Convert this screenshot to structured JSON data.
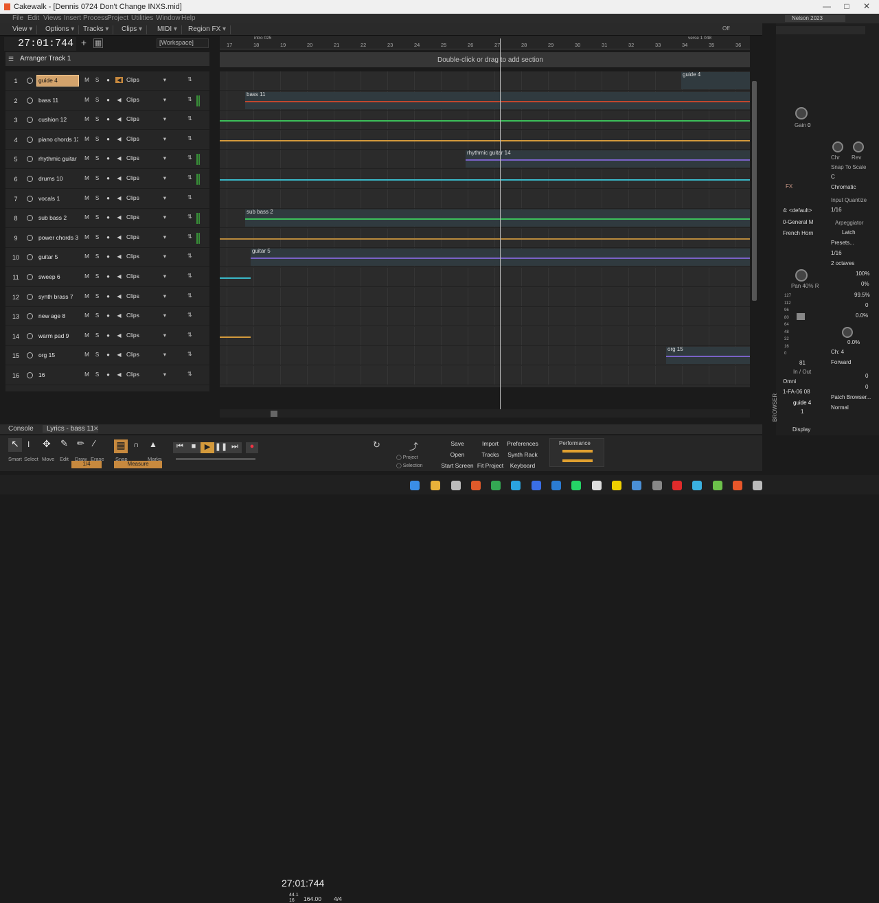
{
  "window": {
    "title": "Cakewalk - [Dennis 0724 Don't Change INXS.mid]"
  },
  "menu": [
    "File",
    "Edit",
    "Views",
    "Insert",
    "Process",
    "Project",
    "Utilities",
    "Window",
    "Help"
  ],
  "user": "Nelson 2023",
  "topbar": [
    "View",
    "Options",
    "Tracks",
    "Clips",
    "MIDI",
    "Region FX"
  ],
  "offlabel": "Off",
  "time": "27:01:744",
  "workspace": "[Workspace]",
  "arranger_track": "Arranger Track 1",
  "section_hint": "Double-click or drag to add section",
  "ruler": {
    "ticks": [
      "17",
      "18",
      "19",
      "20",
      "21",
      "22",
      "23",
      "24",
      "25",
      "26",
      "27",
      "28",
      "29",
      "30",
      "31",
      "32",
      "33",
      "34",
      "35",
      "36"
    ],
    "markers": [
      "intro 025",
      "verse 1 048"
    ]
  },
  "tracks": [
    {
      "num": "1",
      "name": "guide 4",
      "clips": "Clips",
      "meter": false,
      "sel": true
    },
    {
      "num": "2",
      "name": "bass 11",
      "clips": "Clips",
      "meter": true
    },
    {
      "num": "3",
      "name": "cushion 12",
      "clips": "Clips",
      "meter": false
    },
    {
      "num": "4",
      "name": "piano chords 13",
      "clips": "Clips",
      "meter": false
    },
    {
      "num": "5",
      "name": "rhythmic guitar 1",
      "clips": "Clips",
      "meter": true
    },
    {
      "num": "6",
      "name": "drums 10",
      "clips": "Clips",
      "meter": true
    },
    {
      "num": "7",
      "name": "vocals 1",
      "clips": "Clips",
      "meter": false
    },
    {
      "num": "8",
      "name": "sub bass 2",
      "clips": "Clips",
      "meter": true
    },
    {
      "num": "9",
      "name": "power chords 3",
      "clips": "Clips",
      "meter": true
    },
    {
      "num": "10",
      "name": "guitar 5",
      "clips": "Clips",
      "meter": false
    },
    {
      "num": "11",
      "name": "sweep 6",
      "clips": "Clips",
      "meter": false
    },
    {
      "num": "12",
      "name": "synth brass 7",
      "clips": "Clips",
      "meter": false
    },
    {
      "num": "13",
      "name": "new age 8",
      "clips": "Clips",
      "meter": false
    },
    {
      "num": "14",
      "name": "warm pad 9",
      "clips": "Clips",
      "meter": false
    },
    {
      "num": "15",
      "name": "org 15",
      "clips": "Clips",
      "meter": false
    },
    {
      "num": "16",
      "name": "16",
      "clips": "Clips",
      "meter": false
    }
  ],
  "track_btns": {
    "m": "M",
    "s": "S"
  },
  "clip_labels": [
    "guide 4",
    "bass 11",
    "rhythmic guitar 14",
    "sub bass 2",
    "guitar 5",
    "org 15"
  ],
  "bottom_tabs": [
    "Console",
    "Lyrics - bass 11"
  ],
  "tools": [
    "Smart",
    "Select",
    "Move",
    "Edit",
    "Draw",
    "Erase"
  ],
  "tool_value": "1/4",
  "snap": {
    "label": "Snap",
    "marks": "Marks",
    "value": "Measure"
  },
  "transport": {
    "time": "27:01:744",
    "rate_a": "44.1",
    "rate_b": "16",
    "tempo": "164.00",
    "meter": "4/4"
  },
  "radio": [
    "Project",
    "Selection"
  ],
  "buttons": [
    [
      "Save",
      "Import",
      "Preferences"
    ],
    [
      "Open",
      "Tracks",
      "Synth Rack"
    ],
    [
      "Start Screen",
      "Fit Project",
      "Keyboard"
    ]
  ],
  "performance": "Performance",
  "inspector": {
    "gain": "Gain",
    "gain_val": "0",
    "chr": "Chr",
    "rev": "Rev",
    "snap_scale": "Snap To Scale",
    "key": "C",
    "scale": "Chromatic",
    "input_quant": "Input Quantize",
    "quant_val": "1/16",
    "arp": "Arpeggiator",
    "latch": "Latch",
    "presets": "Presets...",
    "arp_rate": "1/16",
    "octaves": "2 octaves",
    "vel": "100%",
    "swing": "0%",
    "dur": "99.5%",
    "pitch": "0",
    "flam": "0.0%",
    "mix": "0.0%",
    "ch": "Ch: 4",
    "forward": "Forward",
    "key_plus": "0",
    "time_plus": "0",
    "patch": "Patch Browser...",
    "normal": "Normal",
    "fx": "FX",
    "in_default": "4: <default>",
    "bank": "0-General M",
    "patch_name": "French Horn",
    "pan": "Pan 40% R",
    "fader_val": "81",
    "inout": "In / Out",
    "omni": "Omni",
    "port": "1-FA-06 08",
    "track": "guide 4",
    "track_num": "1",
    "display": "Display",
    "browser": "BROWSER"
  },
  "scale_nums": [
    "127",
    "112",
    "96",
    "80",
    "64",
    "48",
    "32",
    "16",
    "0"
  ]
}
